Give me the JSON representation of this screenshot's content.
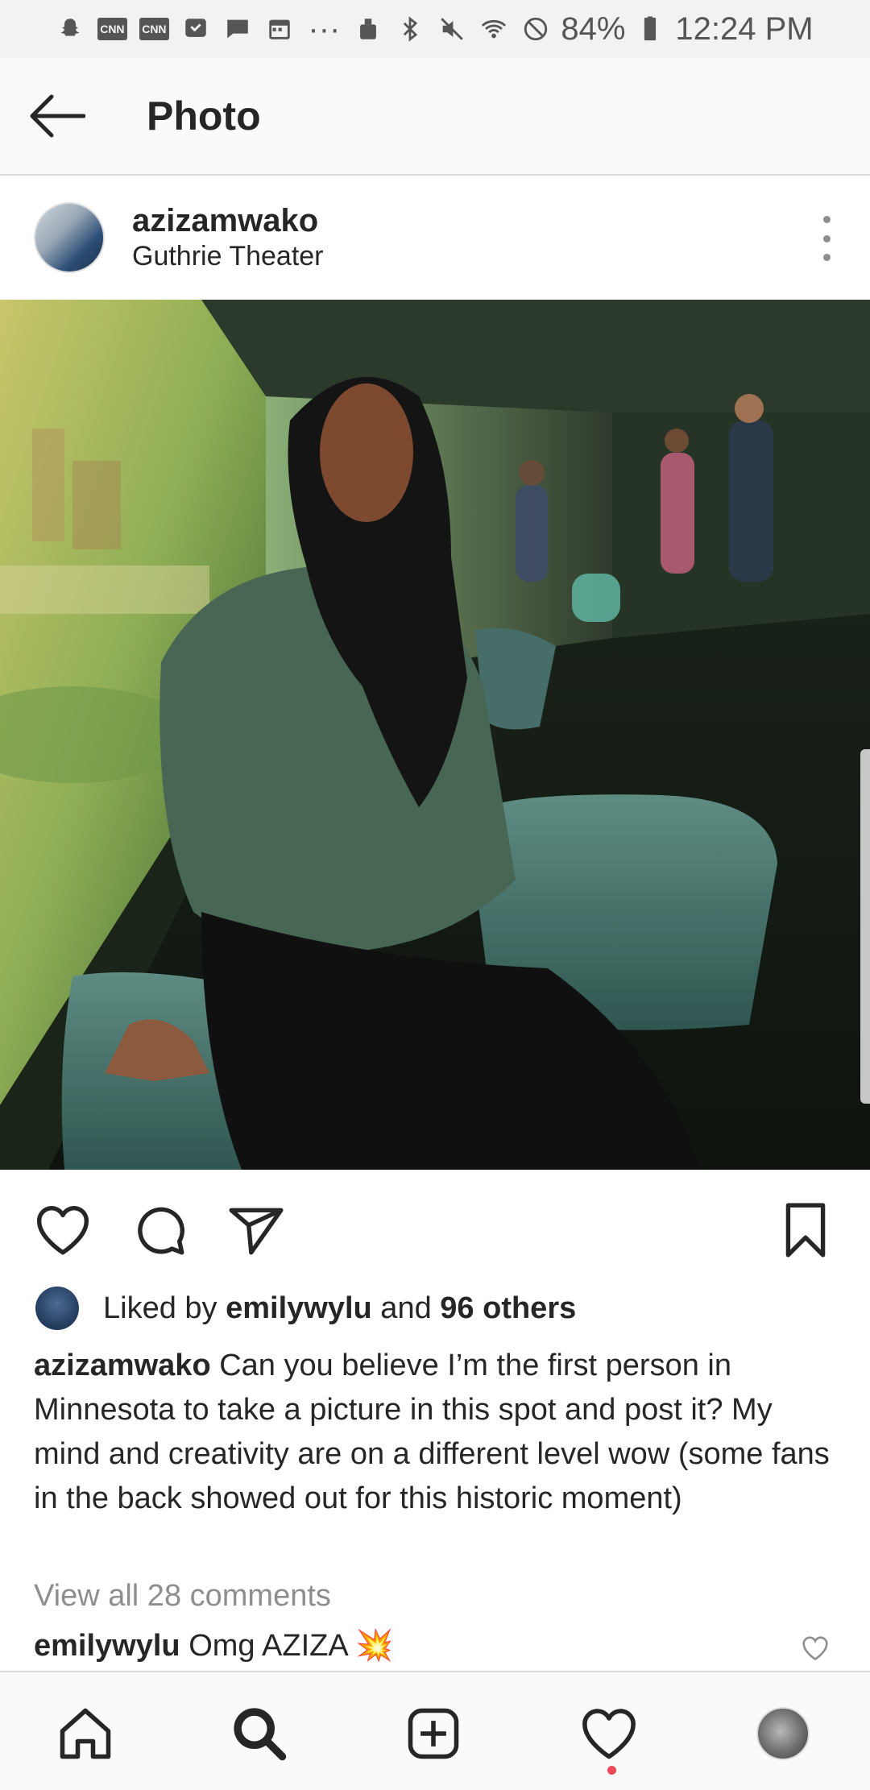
{
  "status_bar": {
    "battery": "84%",
    "time": "12:24 PM",
    "icons": [
      "snapchat-icon",
      "cnn-icon",
      "cnn-icon",
      "gallery-icon",
      "message-icon",
      "calendar-icon",
      "more-icon",
      "android-icon",
      "bluetooth-icon",
      "mute-icon",
      "wifi-icon",
      "dnd-icon",
      "battery-icon"
    ],
    "cnn_label": "CNN",
    "more_label": "···"
  },
  "header": {
    "title": "Photo"
  },
  "post": {
    "username": "azizamwako",
    "location": "Guthrie Theater",
    "likes": {
      "prefix": "Liked by ",
      "user": "emilywylu",
      "mid": " and ",
      "others": "96 others"
    },
    "caption": {
      "username": "azizamwako",
      "text": " Can you believe I’m the first person in Minnesota to take a picture in this spot and post it? My mind and creativity are on a different level wow (some fans in the back showed out for this historic moment)"
    },
    "view_comments": "View all 28 comments",
    "comment": {
      "username": "emilywylu",
      "text": " Omg AZIZA ",
      "emoji": "💥"
    }
  },
  "colors": {
    "accent_red": "#ed4956",
    "muted_text": "#8e8e8e",
    "primary_text": "#262626"
  }
}
